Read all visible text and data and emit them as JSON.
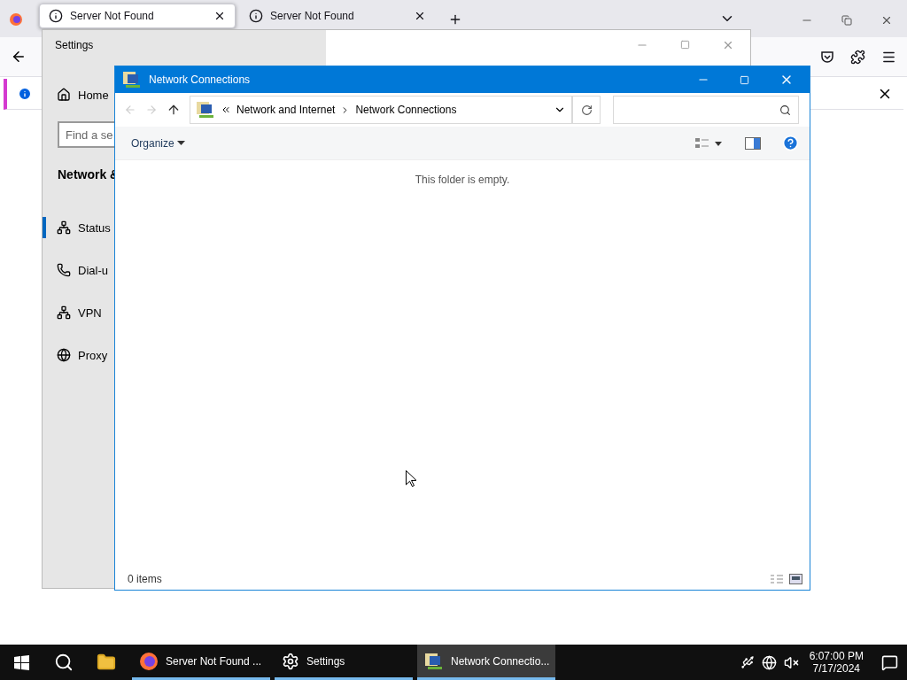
{
  "browser": {
    "tabs": [
      {
        "title": "Server Not Found",
        "selected": true
      },
      {
        "title": "Server Not Found",
        "selected": false
      }
    ]
  },
  "settings_window": {
    "title": "Settings",
    "home": "Home",
    "search": {
      "placeholder": "Find a se"
    },
    "section_title": "Network &",
    "items": [
      {
        "label": "Status",
        "kind": "status",
        "selected": true
      },
      {
        "label": "Dial-u",
        "kind": "dialup",
        "selected": false
      },
      {
        "label": "VPN",
        "kind": "vpn",
        "selected": false
      },
      {
        "label": "Proxy",
        "kind": "proxy",
        "selected": false
      }
    ]
  },
  "explorer": {
    "title": "Network Connections",
    "breadcrumb": [
      "Network and Internet",
      "Network Connections"
    ],
    "organize": "Organize",
    "empty_message": "This folder is empty.",
    "status": "0 items"
  },
  "taskbar": {
    "items": [
      {
        "label": "Server Not Found ...",
        "kind": "firefox",
        "active": false
      },
      {
        "label": "Settings",
        "kind": "settings",
        "active": false
      },
      {
        "label": "Network Connectio...",
        "kind": "network",
        "active": true
      }
    ],
    "time": "6:07:00 PM",
    "date": "7/17/2024"
  }
}
